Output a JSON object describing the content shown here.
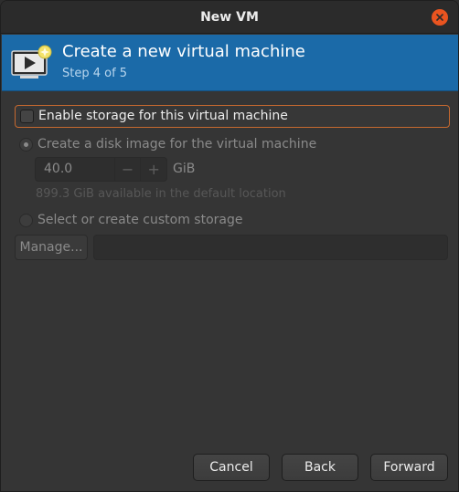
{
  "window": {
    "title": "New VM"
  },
  "banner": {
    "title": "Create a new virtual machine",
    "step": "Step 4 of 5"
  },
  "storage": {
    "enable_label": "Enable storage for this virtual machine",
    "enabled": false,
    "disk_image_label": "Create a disk image for the virtual machine",
    "disk_size_value": "40.0",
    "disk_size_unit": "GiB",
    "decrement_symbol": "−",
    "increment_symbol": "+",
    "available_text": "899.3 GiB available in the default location",
    "custom_label": "Select or create custom storage",
    "manage_label": "Manage...",
    "path_value": ""
  },
  "footer": {
    "cancel_label": "Cancel",
    "back_label": "Back",
    "forward_label": "Forward"
  },
  "colors": {
    "banner": "#1b6aa8",
    "close_button": "#e95420",
    "focus_outline": "#c6692f"
  }
}
